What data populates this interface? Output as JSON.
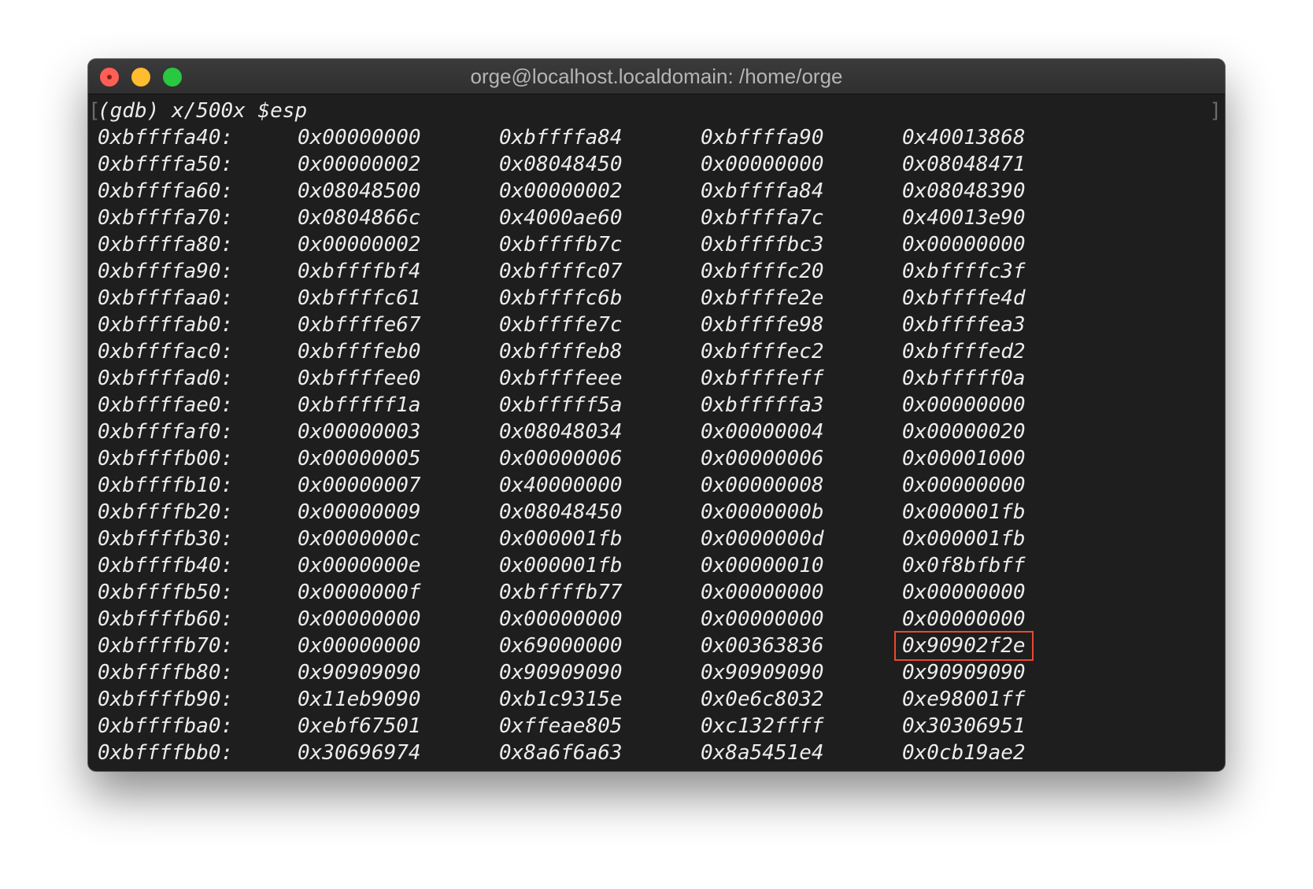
{
  "window": {
    "title": "orge@localhost.localdomain: /home/orge"
  },
  "terminal": {
    "prompt": "(gdb) x/500x $esp",
    "bracket_left": "[",
    "bracket_right": "]",
    "highlight_color": "#e8492f",
    "highlighted_cell": {
      "row": 19,
      "col": 3
    },
    "rows": [
      {
        "addr": "0xbffffa40:",
        "words": [
          "0x00000000",
          "0xbffffa84",
          "0xbffffa90",
          "0x40013868"
        ]
      },
      {
        "addr": "0xbffffa50:",
        "words": [
          "0x00000002",
          "0x08048450",
          "0x00000000",
          "0x08048471"
        ]
      },
      {
        "addr": "0xbffffa60:",
        "words": [
          "0x08048500",
          "0x00000002",
          "0xbffffa84",
          "0x08048390"
        ]
      },
      {
        "addr": "0xbffffa70:",
        "words": [
          "0x0804866c",
          "0x4000ae60",
          "0xbffffa7c",
          "0x40013e90"
        ]
      },
      {
        "addr": "0xbffffa80:",
        "words": [
          "0x00000002",
          "0xbffffb7c",
          "0xbffffbc3",
          "0x00000000"
        ]
      },
      {
        "addr": "0xbffffa90:",
        "words": [
          "0xbffffbf4",
          "0xbffffc07",
          "0xbffffc20",
          "0xbffffc3f"
        ]
      },
      {
        "addr": "0xbffffaa0:",
        "words": [
          "0xbffffc61",
          "0xbffffc6b",
          "0xbffffe2e",
          "0xbffffe4d"
        ]
      },
      {
        "addr": "0xbffffab0:",
        "words": [
          "0xbffffe67",
          "0xbffffe7c",
          "0xbffffe98",
          "0xbffffea3"
        ]
      },
      {
        "addr": "0xbffffac0:",
        "words": [
          "0xbffffeb0",
          "0xbffffeb8",
          "0xbffffec2",
          "0xbffffed2"
        ]
      },
      {
        "addr": "0xbffffad0:",
        "words": [
          "0xbffffee0",
          "0xbffffeee",
          "0xbffffeff",
          "0xbfffff0a"
        ]
      },
      {
        "addr": "0xbffffae0:",
        "words": [
          "0xbfffff1a",
          "0xbfffff5a",
          "0xbfffffa3",
          "0x00000000"
        ]
      },
      {
        "addr": "0xbffffaf0:",
        "words": [
          "0x00000003",
          "0x08048034",
          "0x00000004",
          "0x00000020"
        ]
      },
      {
        "addr": "0xbffffb00:",
        "words": [
          "0x00000005",
          "0x00000006",
          "0x00000006",
          "0x00001000"
        ]
      },
      {
        "addr": "0xbffffb10:",
        "words": [
          "0x00000007",
          "0x40000000",
          "0x00000008",
          "0x00000000"
        ]
      },
      {
        "addr": "0xbffffb20:",
        "words": [
          "0x00000009",
          "0x08048450",
          "0x0000000b",
          "0x000001fb"
        ]
      },
      {
        "addr": "0xbffffb30:",
        "words": [
          "0x0000000c",
          "0x000001fb",
          "0x0000000d",
          "0x000001fb"
        ]
      },
      {
        "addr": "0xbffffb40:",
        "words": [
          "0x0000000e",
          "0x000001fb",
          "0x00000010",
          "0x0f8bfbff"
        ]
      },
      {
        "addr": "0xbffffb50:",
        "words": [
          "0x0000000f",
          "0xbffffb77",
          "0x00000000",
          "0x00000000"
        ]
      },
      {
        "addr": "0xbffffb60:",
        "words": [
          "0x00000000",
          "0x00000000",
          "0x00000000",
          "0x00000000"
        ]
      },
      {
        "addr": "0xbffffb70:",
        "words": [
          "0x00000000",
          "0x69000000",
          "0x00363836",
          "0x90902f2e"
        ]
      },
      {
        "addr": "0xbffffb80:",
        "words": [
          "0x90909090",
          "0x90909090",
          "0x90909090",
          "0x90909090"
        ]
      },
      {
        "addr": "0xbffffb90:",
        "words": [
          "0x11eb9090",
          "0xb1c9315e",
          "0x0e6c8032",
          "0xe98001ff"
        ]
      },
      {
        "addr": "0xbffffba0:",
        "words": [
          "0xebf67501",
          "0xffeae805",
          "0xc132ffff",
          "0x30306951"
        ]
      },
      {
        "addr": "0xbffffbb0:",
        "words": [
          "0x30696974",
          "0x8a6f6a63",
          "0x8a5451e4",
          "0x0cb19ae2"
        ]
      }
    ]
  }
}
